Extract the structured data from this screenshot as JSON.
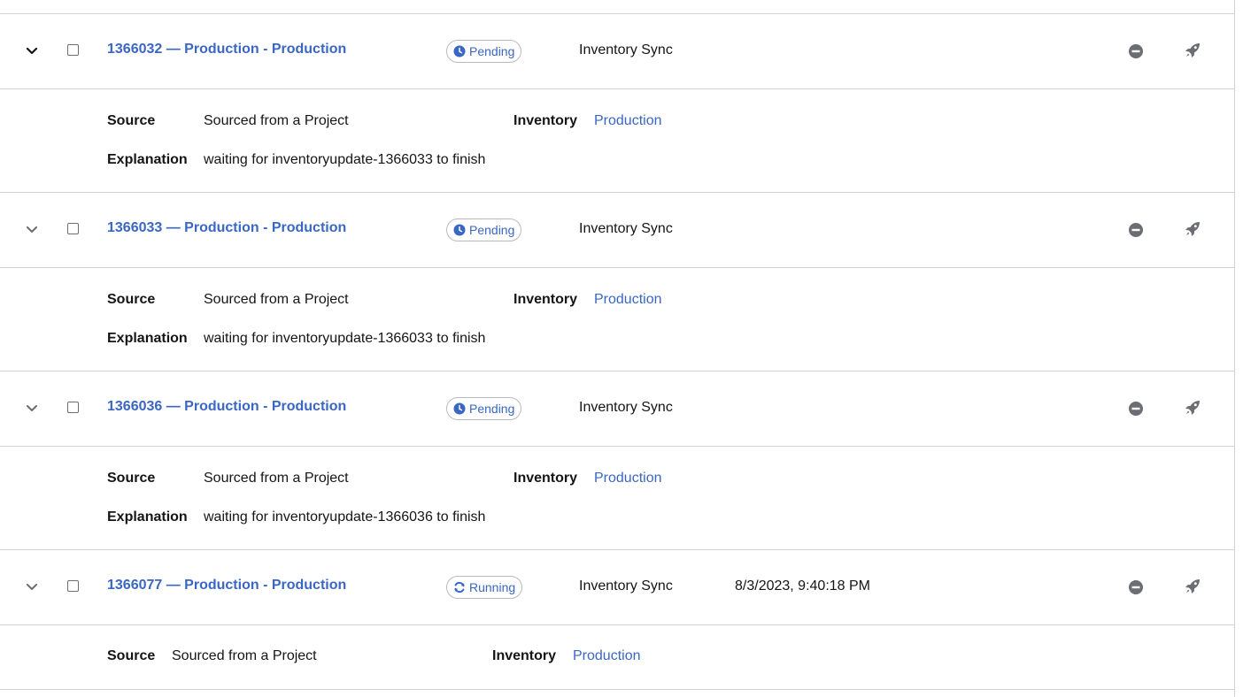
{
  "jobs": [
    {
      "name": "1366032 — Production - Production",
      "status": "Pending",
      "status_icon": "clock-icon",
      "type": "Inventory Sync",
      "started": "",
      "expanded": true,
      "details": {
        "source_label": "Source",
        "source_value": "Sourced from a Project",
        "inventory_label": "Inventory",
        "inventory_value": "Production",
        "explanation_label": "Explanation",
        "explanation_value": "waiting for inventoryupdate-1366033 to finish"
      }
    },
    {
      "name": "1366033 — Production - Production",
      "status": "Pending",
      "status_icon": "clock-icon",
      "type": "Inventory Sync",
      "started": "",
      "expanded": false,
      "details": {
        "source_label": "Source",
        "source_value": "Sourced from a Project",
        "inventory_label": "Inventory",
        "inventory_value": "Production",
        "explanation_label": "Explanation",
        "explanation_value": "waiting for inventoryupdate-1366033 to finish"
      }
    },
    {
      "name": "1366036 — Production - Production",
      "status": "Pending",
      "status_icon": "clock-icon",
      "type": "Inventory Sync",
      "started": "",
      "expanded": false,
      "details": {
        "source_label": "Source",
        "source_value": "Sourced from a Project",
        "inventory_label": "Inventory",
        "inventory_value": "Production",
        "explanation_label": "Explanation",
        "explanation_value": "waiting for inventoryupdate-1366036 to finish"
      }
    },
    {
      "name": "1366077 — Production - Production",
      "status": "Running",
      "status_icon": "sync-icon",
      "type": "Inventory Sync",
      "started": "8/3/2023, 9:40:18 PM",
      "expanded": false,
      "details": {
        "source_label": "Source",
        "source_value": "Sourced from a Project",
        "inventory_label": "Inventory",
        "inventory_value": "Production"
      }
    }
  ],
  "colors": {
    "link": "#3a67c4",
    "border": "#d2d2d2",
    "icon": "#6a6e73",
    "text": "#151515"
  }
}
